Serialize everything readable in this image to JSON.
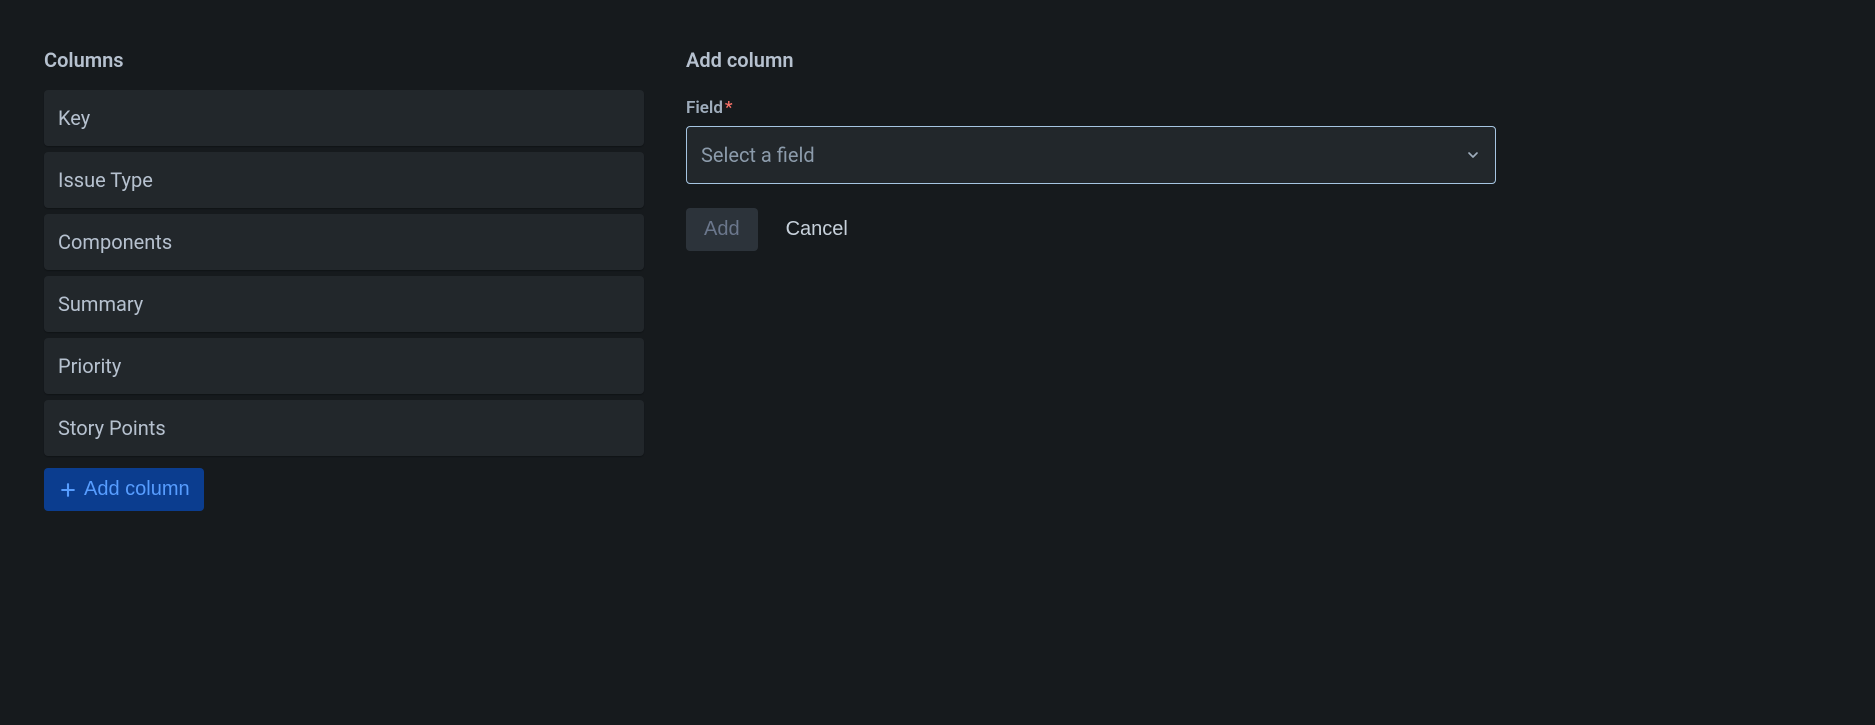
{
  "left": {
    "title": "Columns",
    "items": [
      {
        "label": "Key"
      },
      {
        "label": "Issue Type"
      },
      {
        "label": "Components"
      },
      {
        "label": "Summary"
      },
      {
        "label": "Priority"
      },
      {
        "label": "Story Points"
      }
    ],
    "add_button_label": "Add column"
  },
  "right": {
    "title": "Add column",
    "field_label": "Field",
    "required_mark": "*",
    "select_placeholder": "Select a field",
    "add_button_label": "Add",
    "cancel_button_label": "Cancel"
  }
}
